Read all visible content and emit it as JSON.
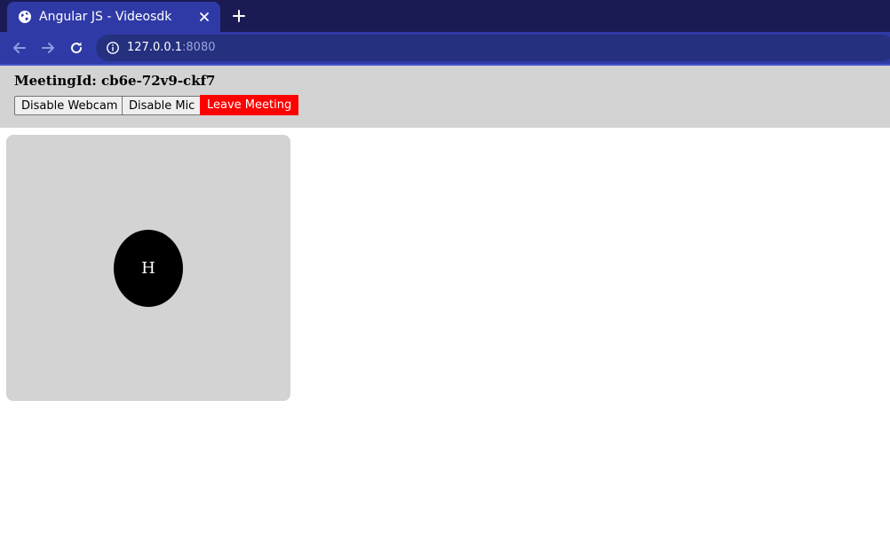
{
  "browser": {
    "tab_title": "Angular JS - Videosdk",
    "url_host": "127.0.0.1",
    "url_port": ":8080",
    "colors": {
      "tab_strip": "#1b1b54",
      "active_tab": "#2f3aa6",
      "toolbar": "#2f3aa6",
      "omnibox": "#25307f"
    },
    "icons": [
      "globe-icon",
      "close-icon",
      "plus-icon",
      "back-arrow-icon",
      "forward-arrow-icon",
      "reload-icon",
      "info-icon"
    ]
  },
  "meeting": {
    "id_label": "MeetingId: cb6e-72v9-ckf7",
    "buttons": {
      "webcam_label": "Disable Webcam",
      "mic_label": "Disable Mic",
      "leave_label": "Leave Meeting"
    },
    "colors": {
      "controls_bg": "#d3d3d3",
      "leave_bg": "#ff0000"
    }
  },
  "participant": {
    "initial": "H",
    "tile_color": "#d3d3d3",
    "avatar_color": "#000000"
  }
}
